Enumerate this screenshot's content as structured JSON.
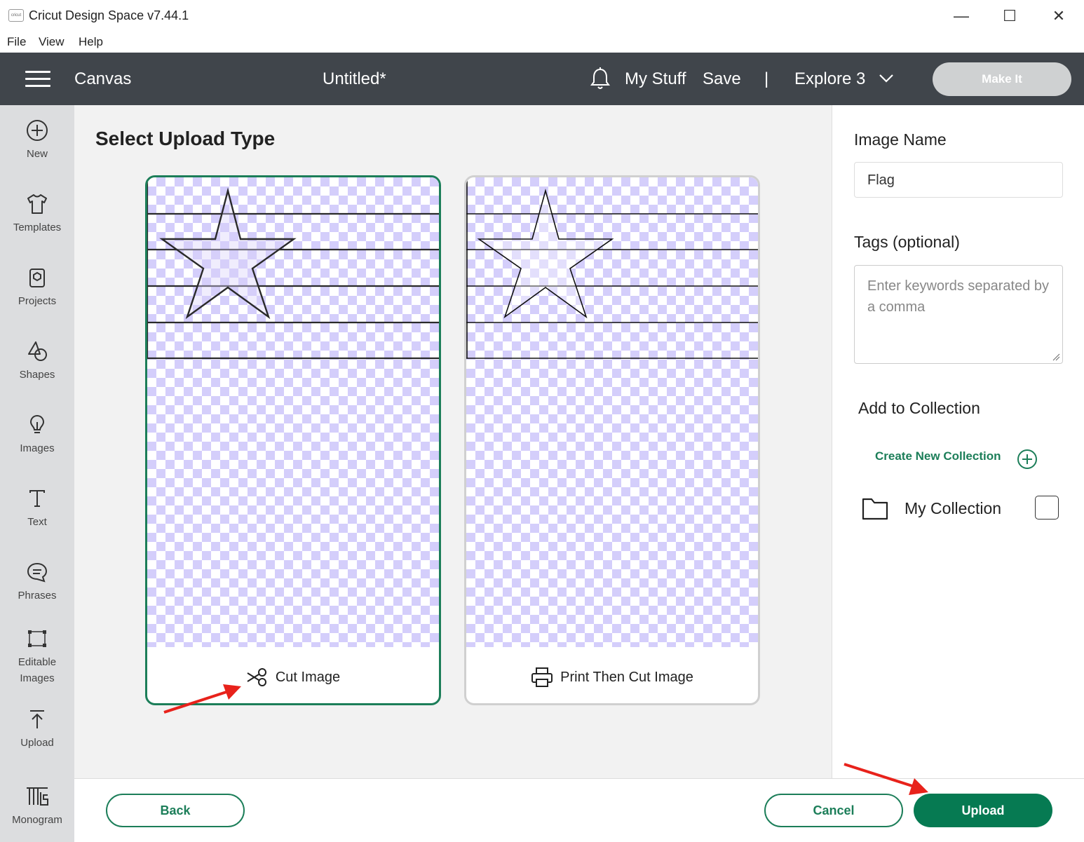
{
  "window": {
    "logo_text": "cricut",
    "title": "Cricut Design Space  v7.44.1",
    "minimize": "—",
    "maximize": "☐",
    "close": "✕"
  },
  "menu": [
    "File",
    "View",
    "Help"
  ],
  "appbar": {
    "section": "Canvas",
    "document": "Untitled*",
    "my_stuff": "My Stuff",
    "save": "Save",
    "separator": "|",
    "machine": "Explore 3",
    "make_it": "Make It"
  },
  "sidebar": {
    "items": [
      {
        "label": "New",
        "icon": "plus-circle-icon"
      },
      {
        "label": "Templates",
        "icon": "tshirt-icon"
      },
      {
        "label": "Projects",
        "icon": "projects-icon"
      },
      {
        "label": "Shapes",
        "icon": "shapes-icon"
      },
      {
        "label": "Images",
        "icon": "lightbulb-icon"
      },
      {
        "label": "Text",
        "icon": "text-icon"
      },
      {
        "label": "Phrases",
        "icon": "speech-bubble-icon"
      },
      {
        "label": "Editable Images",
        "icon": "editable-images-icon"
      },
      {
        "label": "Upload",
        "icon": "upload-icon"
      },
      {
        "label": "Monogram",
        "icon": "monogram-icon"
      }
    ]
  },
  "main": {
    "title": "Select Upload Type",
    "cards": [
      {
        "label": "Cut Image",
        "icon": "scissors-icon",
        "selected": true
      },
      {
        "label": "Print Then Cut Image",
        "icon": "printer-icon",
        "selected": false
      }
    ]
  },
  "right_panel": {
    "image_name_label": "Image Name",
    "image_name_value": "Flag",
    "tags_label": "Tags (optional)",
    "tags_placeholder": "Enter keywords separated by a comma",
    "collection_label": "Add to Collection",
    "create_collection": "Create New Collection",
    "collection_item": "My Collection"
  },
  "footer": {
    "back": "Back",
    "cancel": "Cancel",
    "upload": "Upload"
  },
  "colors": {
    "accent": "#1c7e59",
    "appbar": "#40454b",
    "arrow": "#e8221b",
    "checker": "#d4cefb"
  }
}
